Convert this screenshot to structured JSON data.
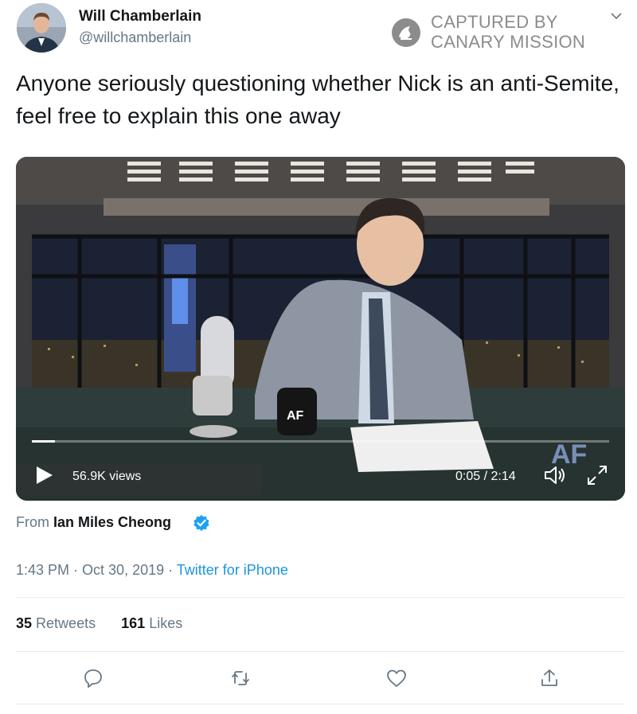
{
  "author": {
    "display_name": "Will Chamberlain",
    "handle": "@willchamberlain"
  },
  "watermark": {
    "line1": "CAPTURED BY",
    "line2": "CANARY MISSION"
  },
  "tweet": {
    "text": "Anyone seriously questioning whether Nick is an anti-Semite, feel free to explain this one away"
  },
  "video": {
    "views": "56.9K views",
    "time": "0:05 / 2:14",
    "progress": 0.04
  },
  "attribution": {
    "prefix": "From ",
    "name": "Ian Miles Cheong"
  },
  "meta": {
    "time": "1:43 PM",
    "separator": " · ",
    "date": "Oct 30, 2019",
    "source": "Twitter for iPhone"
  },
  "stats": {
    "retweets_count": "35",
    "retweets_label": "Retweets",
    "likes_count": "161",
    "likes_label": "Likes"
  },
  "colors": {
    "link": "#1b95e0",
    "verified": "#1da1f2",
    "muted": "#657786"
  },
  "icons": [
    "avatar",
    "canary-mission-logo",
    "chevron-down-icon",
    "play-icon",
    "volume-icon",
    "fullscreen-icon",
    "verified-badge-icon",
    "reply-icon",
    "retweet-icon",
    "like-icon",
    "share-icon"
  ]
}
